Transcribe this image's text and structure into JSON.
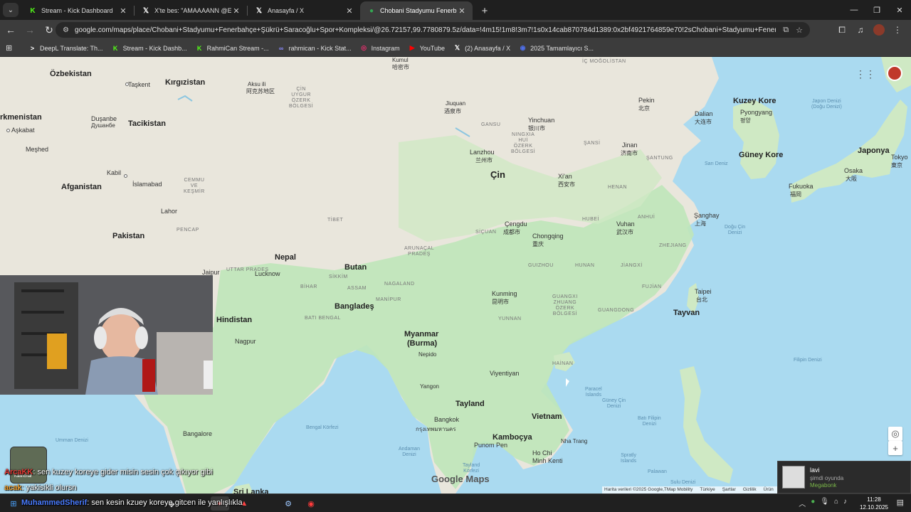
{
  "browser": {
    "tabs": [
      {
        "label": "Stream - Kick Dashboard",
        "active": false
      },
      {
        "label": "X'te bes: \"AMAAAANN @Eboni",
        "active": false
      },
      {
        "label": "Anasayfa / X",
        "active": false
      },
      {
        "label": "Chobani Stadyumu Fenerbahçe",
        "active": true
      }
    ],
    "url": "google.com/maps/place/Chobani+Stadyumu+Fenerbahçe+Şükrü+Saracoğlu+Spor+Kompleksi/@26.72157,99.7780879.5z/data=!4m15!1m8!3m7!1s0x14cab870784d1389:0x2bf4921764859e70!2sChobani+Stadyumu+Fenerbahçe+Şükrü+Saraco..."
  },
  "bookmarks": [
    {
      "label": "DeepL Translate: Th...",
      "color": "#0f2b46"
    },
    {
      "label": "Stream - Kick Dashb...",
      "color": "#53fc18"
    },
    {
      "label": "RahmiCan Stream -...",
      "color": "#53fc18"
    },
    {
      "label": "rahmican - Kick Stat...",
      "color": "#6b6bff"
    },
    {
      "label": "Instagram",
      "color": "#e1306c"
    },
    {
      "label": "YouTube",
      "color": "#ff0000"
    },
    {
      "label": "(2) Anasayfa / X",
      "color": "#ffffff"
    },
    {
      "label": "2025 Tamamlayıcı S...",
      "color": "#2a4cd0"
    }
  ],
  "map": {
    "countries": {
      "ozbekistan": "Özbekistan",
      "kirgizistan": "Kırgızistan",
      "turkmenistan": "rkmenistan",
      "tacikistan": "Tacikistan",
      "afganistan": "Afganistan",
      "pakistan": "Pakistan",
      "nepal": "Nepal",
      "butan": "Butan",
      "hindistan": "Hindistan",
      "banglades": "Bangladeş",
      "myanmar": "Myanmar",
      "burma": "(Burma)",
      "tayland": "Tayland",
      "kambocya": "Kamboçya",
      "vietnam": "Vietnam",
      "cin": "Çin",
      "kuzey_kore": "Kuzey Kore",
      "guney_kore": "Güney Kore",
      "japonya": "Japonya",
      "tayvan": "Tayvan",
      "sri_lanka": "Sri Lanka"
    },
    "cities": {
      "askabat": "Aşkabat",
      "meshed": "Meşhed",
      "taskent": "Taşkent",
      "dusanbe": "Duşanbe",
      "dusanbe_ru": "Душанбе",
      "kabil": "Kabil",
      "islamabad": "İslamabad",
      "lahor": "Lahor",
      "aksu": "Aksu ili",
      "aksu_cn": "阿克苏地区",
      "lucknow": "Lucknow",
      "jaipur": "Jaipur",
      "nagpur": "Nagpur",
      "bangalore": "Bangalore",
      "nepido": "Nepido",
      "yangon": "Yangon",
      "bangkok": "Bangkok",
      "bangkok_th": "กรุงเทพมหานคร",
      "vientiane": "Viyentiyan",
      "pnom_pen": "Punom Pen",
      "ho_chi_minh": "Ho Chi",
      "ho_chi_minh2": "Minh Kenti",
      "nha_trang": "Nha Trang",
      "kunming": "Kunming",
      "kunming_cn": "昆明市",
      "cengdu": "Çengdu",
      "cengdu_cn": "成都市",
      "chongqing": "Chongqing",
      "chongqing_cn": "重庆",
      "lanzhou": "Lanzhou",
      "lanzhou_cn": "兰州市",
      "xian": "Xi'an",
      "xian_cn": "西安市",
      "yinchuan": "Yinchuan",
      "yinchuan_cn": "银川市",
      "jinan": "Jinan",
      "jinan_cn": "济南市",
      "pekin": "Pekin",
      "pekin_cn": "北京",
      "vuhan": "Vuhan",
      "vuhan_cn": "武汉市",
      "sanghay": "Şanghay",
      "sanghay_cn": "上海",
      "dalian": "Dalian",
      "dalian_cn": "大连市",
      "pyongyang": "Pyongyang",
      "pyongyang_kr": "평양",
      "fukuoka": "Fukuoka",
      "fukuoka_jp": "福岡",
      "osaka": "Osaka",
      "osaka_jp": "大阪",
      "tokyo": "Tokyo",
      "tokyo_jp": "東京",
      "taipei": "Taipei",
      "taipei_cn": "台北",
      "jiuquan": "Jiuquan",
      "jiuquan_cn": "酒泉市",
      "kumul": "Kumul",
      "kumul_cn": "哈密市"
    },
    "regions": {
      "uygur": "ÇİN\nUYGUR\nÖZERK\nBÖLGESİ",
      "tibet": "TİBET",
      "ic_mogolistan": "İÇ MOĞOLİSTAN",
      "gansu": "GANSU",
      "ningxia": "NINGXIA\nHUİ\nÖZERK\nBÖLGESİ",
      "sansi": "ŞANSİ",
      "santung": "ŞANTUNG",
      "henan": "HENAN",
      "hubei": "HUBEİ",
      "hunan": "HUNAN",
      "sicuan": "SİÇUAN",
      "guizhou": "GUIZHOU",
      "yunnan": "YUNNAN",
      "guangxi": "GUANGXI\nZHUANG\nÖZERK\nBÖLGESİ",
      "guangdong": "GUANGDONG",
      "fujian": "FUJİAN",
      "jiangxi": "JİANGXİ",
      "zhejiang": "ZHEJIANG",
      "anhui": "ANHUİ",
      "cemmu": "CEMMU\nVE\nKEŞMİR",
      "pencap": "PENCAP",
      "uttar": "UTTAR PRADEŞ",
      "bihar": "BİHAR",
      "bati_bengal": "BATI BENGAL",
      "assam": "ASSAM",
      "nagaland": "NAGALAND",
      "manipur": "MANİPUR",
      "arunacal": "ARUNAÇAL\nPRADEŞ",
      "sikkim": "SİKKİM",
      "hainan": "HAİNAN"
    },
    "seas": {
      "japon_denizi": "Japon Denizi\n(Doğu Denizi)",
      "sari_deniz": "Sarı Deniz",
      "dogu_cin": "Doğu Çin\nDenizi",
      "guney_cin": "Güney Çin\nDenizi",
      "filipin": "Filipin Denizi",
      "bati_filipin": "Batı Filipin\nDenizi",
      "bengal": "Bengal Körfezi",
      "umman": "Umman Denizi",
      "andaman": "Andaman\nDenizi",
      "tayland_korfezi": "Tayland\nKörfezi",
      "sulu": "Sulu Denizi",
      "paracel": "Paracel\nIslands",
      "spratly": "Spratly\nIslands",
      "palawan": "Palawan"
    },
    "logo": "Google Maps",
    "attribution": [
      "Harita verileri ©2025 Google,TMap Mobility",
      "Türkiye",
      "Şartlar",
      "Gizlilik",
      "Ürün"
    ]
  },
  "chat": [
    {
      "user": "ArcaKK",
      "text": ": sen kuzey koreye gider misin sesin çok çıkıyor gibi",
      "color": "#e53935"
    },
    {
      "user": "acak",
      "text": ": yakisikli olursn",
      "color": "#f0a030"
    },
    {
      "user": "MuhammedSherif",
      "text": ": sen kesin kzuey koreye gitcen ile yanlışlıkla",
      "color": "#4a7cff"
    }
  ],
  "chat_thumb_label": "Kalinchar",
  "notification": {
    "name": "lavi",
    "status": "şimdi oyunda",
    "game": "Megabonk"
  },
  "taskbar": {
    "time": "11:28",
    "date": "12.10.2025"
  }
}
